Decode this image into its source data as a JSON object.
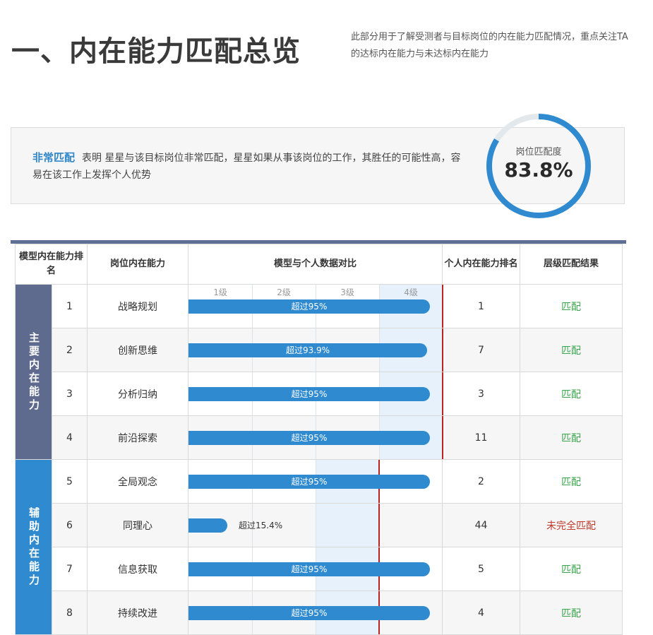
{
  "header": {
    "title": "一、内在能力匹配总览",
    "description": "此部分用于了解受测者与目标岗位的内在能力匹配情况，重点关注TA的达标内在能力与未达标内在能力"
  },
  "summary": {
    "label": "非常匹配",
    "text": "表明 星星与该目标岗位非常匹配，星星如果从事该岗位的工作，其胜任的可能性高，容易在该工作上发挥个人优势"
  },
  "gauge": {
    "label": "岗位匹配度",
    "value_text": "83.8%",
    "fraction": 0.838,
    "color": "#2f8ad0",
    "track_color": "#e3e8ec"
  },
  "table": {
    "headers": [
      "模型内在能力排名",
      "岗位内在能力",
      "模型与个人数据对比",
      "个人内在能力排名",
      "层级匹配结果"
    ],
    "levels": [
      "1级",
      "2级",
      "3级",
      "4级"
    ],
    "groups": [
      {
        "name": "主要内在能力",
        "color": "#5e6b8f"
      },
      {
        "name": "辅助内在能力",
        "color": "#2f8ad0"
      }
    ],
    "rows": [
      {
        "rank": "1",
        "ability": "战略规划",
        "bar_text": "超过95%",
        "bar_fraction": 0.95,
        "personal_rank": "1",
        "result": "匹配",
        "ok": true,
        "group": 0
      },
      {
        "rank": "2",
        "ability": "创新思维",
        "bar_text": "超过93.9%",
        "bar_fraction": 0.939,
        "personal_rank": "7",
        "result": "匹配",
        "ok": true,
        "group": 0
      },
      {
        "rank": "3",
        "ability": "分析归纳",
        "bar_text": "超过95%",
        "bar_fraction": 0.95,
        "personal_rank": "3",
        "result": "匹配",
        "ok": true,
        "group": 0
      },
      {
        "rank": "4",
        "ability": "前沿探索",
        "bar_text": "超过95%",
        "bar_fraction": 0.95,
        "personal_rank": "11",
        "result": "匹配",
        "ok": true,
        "group": 0
      },
      {
        "rank": "5",
        "ability": "全局观念",
        "bar_text": "超过95%",
        "bar_fraction": 0.95,
        "personal_rank": "2",
        "result": "匹配",
        "ok": true,
        "group": 1
      },
      {
        "rank": "6",
        "ability": "同理心",
        "bar_text": "超过15.4%",
        "bar_fraction": 0.154,
        "personal_rank": "44",
        "result": "未完全匹配",
        "ok": false,
        "group": 1
      },
      {
        "rank": "7",
        "ability": "信息获取",
        "bar_text": "超过95%",
        "bar_fraction": 0.95,
        "personal_rank": "5",
        "result": "匹配",
        "ok": true,
        "group": 1
      },
      {
        "rank": "8",
        "ability": "持续改进",
        "bar_text": "超过95%",
        "bar_fraction": 0.95,
        "personal_rank": "4",
        "result": "匹配",
        "ok": true,
        "group": 1
      }
    ],
    "group_target_level": [
      4,
      3
    ]
  }
}
